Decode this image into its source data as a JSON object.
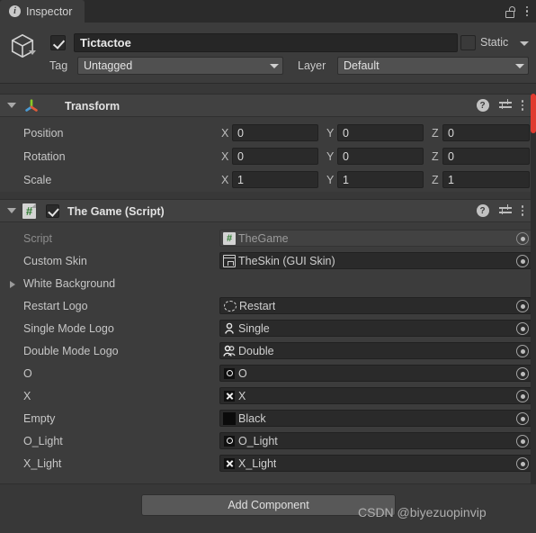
{
  "window": {
    "tab_label": "Inspector",
    "tab_icon": "info-icon",
    "lock_icon": "lock-open-icon",
    "menu_icon": "kebab-menu-icon"
  },
  "gameobject": {
    "icon": "cube-icon",
    "enabled": true,
    "name": "Tictactoe",
    "static_label": "Static",
    "static_checked": false,
    "tag_label": "Tag",
    "tag_value": "Untagged",
    "layer_label": "Layer",
    "layer_value": "Default"
  },
  "transform": {
    "title": "Transform",
    "icon": "transform-gizmo-icon",
    "expanded": true,
    "help_icon": "help-icon",
    "preset_icon": "preset-settings-icon",
    "menu_icon": "kebab-menu-icon",
    "rows": [
      {
        "label": "Position",
        "x": "0",
        "y": "0",
        "z": "0"
      },
      {
        "label": "Rotation",
        "x": "0",
        "y": "0",
        "z": "0"
      },
      {
        "label": "Scale",
        "x": "1",
        "y": "1",
        "z": "1"
      }
    ],
    "axis_labels": {
      "x": "X",
      "y": "Y",
      "z": "Z"
    }
  },
  "script_component": {
    "title": "The Game (Script)",
    "icon": "csharp-script-icon",
    "enabled": true,
    "expanded": true,
    "help_icon": "help-icon",
    "preset_icon": "preset-settings-icon",
    "menu_icon": "kebab-menu-icon",
    "properties": [
      {
        "label": "Script",
        "value": "TheGame",
        "icon": "csharp-script-icon",
        "readonly": true,
        "foldout": false,
        "has_value": true
      },
      {
        "label": "Custom Skin",
        "value": "TheSkin (GUI Skin)",
        "icon": "gui-skin-icon",
        "readonly": false,
        "foldout": false,
        "has_value": true
      },
      {
        "label": "White Background",
        "value": "",
        "icon": "",
        "readonly": false,
        "foldout": true,
        "has_value": false
      },
      {
        "label": "Restart Logo",
        "value": "Restart",
        "icon": "restart-sprite-icon",
        "readonly": false,
        "foldout": false,
        "has_value": true
      },
      {
        "label": "Single Mode Logo",
        "value": "Single",
        "icon": "single-person-icon",
        "readonly": false,
        "foldout": false,
        "has_value": true
      },
      {
        "label": "Double Mode Logo",
        "value": "Double",
        "icon": "double-person-icon",
        "readonly": false,
        "foldout": false,
        "has_value": true
      },
      {
        "label": "O",
        "value": "O",
        "icon": "o-sprite-icon",
        "readonly": false,
        "foldout": false,
        "has_value": true
      },
      {
        "label": "X",
        "value": "X",
        "icon": "x-sprite-icon",
        "readonly": false,
        "foldout": false,
        "has_value": true
      },
      {
        "label": "Empty",
        "value": "Black",
        "icon": "black-sprite-icon",
        "readonly": false,
        "foldout": false,
        "has_value": true
      },
      {
        "label": "O_Light",
        "value": "O_Light",
        "icon": "o-sprite-icon",
        "readonly": false,
        "foldout": false,
        "has_value": true
      },
      {
        "label": "X_Light",
        "value": "X_Light",
        "icon": "x-sprite-icon",
        "readonly": false,
        "foldout": false,
        "has_value": true
      }
    ],
    "picker_icon": "object-picker-icon"
  },
  "footer": {
    "add_component_label": "Add Component",
    "watermark": "CSDN @biyezuopinvip"
  },
  "scrollbar": {
    "accent_color": "#e03b2f"
  }
}
